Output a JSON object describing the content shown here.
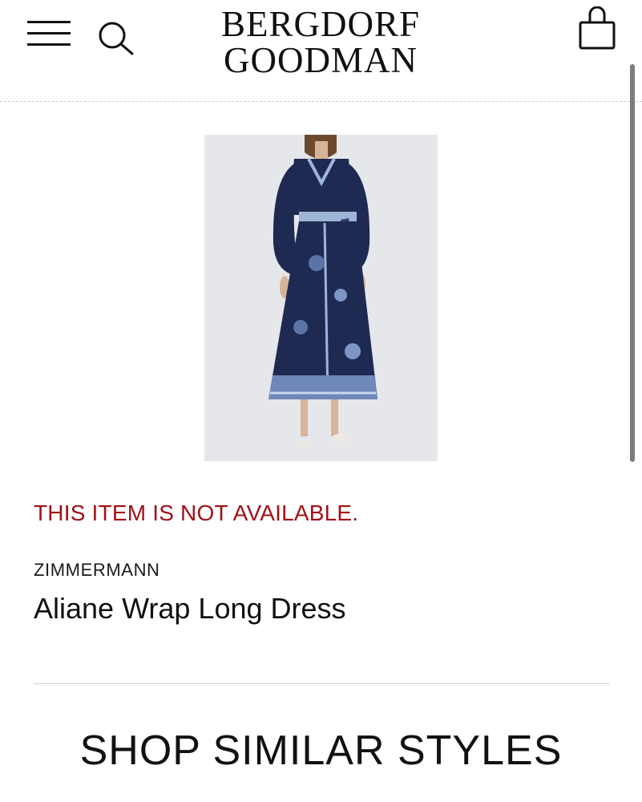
{
  "header": {
    "logo_line1": "BERGDORF",
    "logo_line2": "GOODMAN",
    "menu_icon": "hamburger-menu-icon",
    "search_icon": "search-icon",
    "bag_icon": "shopping-bag-icon"
  },
  "product": {
    "status": "THIS ITEM IS NOT AVAILABLE.",
    "status_color": "#a11217",
    "designer": "ZIMMERMANN",
    "name": "Aliane Wrap Long Dress"
  },
  "similar": {
    "heading": "SHOP SIMILAR STYLES"
  }
}
